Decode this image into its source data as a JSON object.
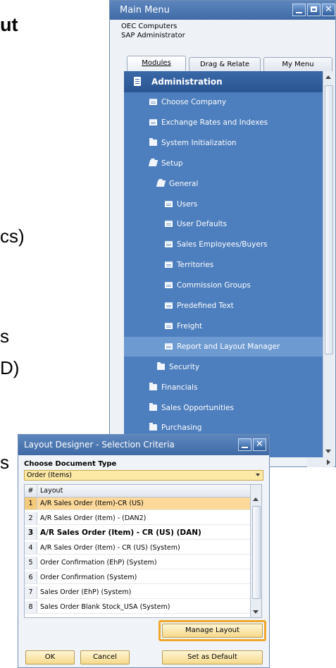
{
  "slide_fragments": {
    "ut": "ut",
    "cs": "cs)",
    "s": "s",
    "d": "D)",
    "s2": "s"
  },
  "main_menu": {
    "title": "Main Menu",
    "company": "OEC Computers",
    "user": "SAP Administrator",
    "tabs": [
      {
        "label": "Modules"
      },
      {
        "label": "Drag & Relate"
      },
      {
        "label": "My Menu"
      }
    ],
    "section_header": "Administration",
    "items": [
      {
        "label": "Choose Company",
        "icon": "form-icon"
      },
      {
        "label": "Exchange Rates and Indexes",
        "icon": "form-icon"
      },
      {
        "label": "System Initialization",
        "icon": "folder-icon"
      },
      {
        "label": "Setup",
        "icon": "folder-open-icon"
      },
      {
        "label": "General",
        "icon": "folder-open-icon"
      },
      {
        "label": "Users",
        "icon": "form-icon"
      },
      {
        "label": "User Defaults",
        "icon": "form-icon"
      },
      {
        "label": "Sales Employees/Buyers",
        "icon": "form-icon"
      },
      {
        "label": "Territories",
        "icon": "form-icon"
      },
      {
        "label": "Commission Groups",
        "icon": "form-icon"
      },
      {
        "label": "Predefined Text",
        "icon": "form-icon"
      },
      {
        "label": "Freight",
        "icon": "form-icon"
      },
      {
        "label": "Report and Layout Manager",
        "icon": "form-icon",
        "selected": true
      },
      {
        "label": "Security",
        "icon": "folder-icon"
      },
      {
        "label": "Financials",
        "icon": "folder-icon"
      },
      {
        "label": "Sales Opportunities",
        "icon": "folder-icon"
      },
      {
        "label": "Purchasing",
        "icon": "folder-icon"
      }
    ],
    "colors": {
      "tree_bg": "#4d7ebd",
      "header_bg": "#2a5592",
      "selected_bg": "#6d9ad1"
    }
  },
  "layout_designer": {
    "title": "Layout Designer - Selection Criteria",
    "choose_label": "Choose Document Type",
    "document_type": "Order (Items)",
    "columns": {
      "num": "#",
      "layout": "Layout"
    },
    "rows": [
      {
        "num": "1",
        "layout": "A/R Sales Order (Item)-CR (US)",
        "selected": true
      },
      {
        "num": "2",
        "layout": "A/R Sales Order (Item) - (DAN2)"
      },
      {
        "num": "3",
        "layout": "A/R Sales Order (Item) - CR (US) (DAN)",
        "bold": true
      },
      {
        "num": "4",
        "layout": "A/R Sales Order (Item) - CR (US) (System)"
      },
      {
        "num": "5",
        "layout": "Order Confirmation (EhP) (System)"
      },
      {
        "num": "6",
        "layout": "Order Confirmation (System)"
      },
      {
        "num": "7",
        "layout": "Sales Order (EhP) (System)"
      },
      {
        "num": "8",
        "layout": "Sales Order Blank Stock_USA (System)"
      }
    ],
    "buttons": {
      "manage_layout": "Manage Layout",
      "ok": "OK",
      "cancel": "Cancel",
      "set_default": "Set as Default"
    },
    "colors": {
      "selection": "#fcd99a",
      "highlight": "#f0a82a"
    }
  }
}
